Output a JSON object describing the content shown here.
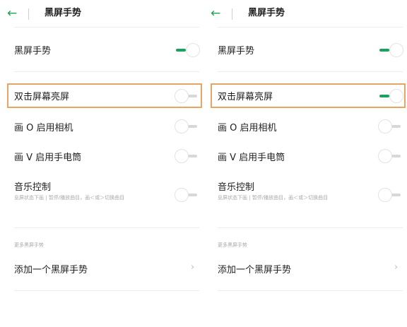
{
  "panels": [
    {
      "header": {
        "back_icon": "arrow-left-icon",
        "title": "黑屏手势"
      },
      "items": [
        {
          "label": "黑屏手势",
          "toggle": "on"
        },
        {
          "label": "双击屏幕亮屏",
          "toggle": "off"
        },
        {
          "label": "画 O 启用相机",
          "toggle": "off"
        },
        {
          "label": "画 V 启用手电筒",
          "toggle": "off"
        },
        {
          "label": "音乐控制",
          "desc": "息屏状态下画 | 暂停/播放曲目，画＜或＞切换曲目",
          "toggle": "off"
        }
      ],
      "section_head": "更多黑屏手势",
      "add_label": "添加一个黑屏手势"
    },
    {
      "header": {
        "back_icon": "arrow-left-icon",
        "title": "黑屏手势"
      },
      "items": [
        {
          "label": "黑屏手势",
          "toggle": "on"
        },
        {
          "label": "双击屏幕亮屏",
          "toggle": "on"
        },
        {
          "label": "画 O 启用相机",
          "toggle": "off"
        },
        {
          "label": "画 V 启用手电筒",
          "toggle": "off"
        },
        {
          "label": "音乐控制",
          "desc": "息屏状态下画 | 暂停/播放曲目，画＜或＞切换曲目",
          "toggle": "off"
        }
      ],
      "section_head": "更多黑屏手势",
      "add_label": "添加一个黑屏手势"
    }
  ],
  "colors": {
    "accent": "#1aa35d",
    "highlight": "#e6a561"
  }
}
